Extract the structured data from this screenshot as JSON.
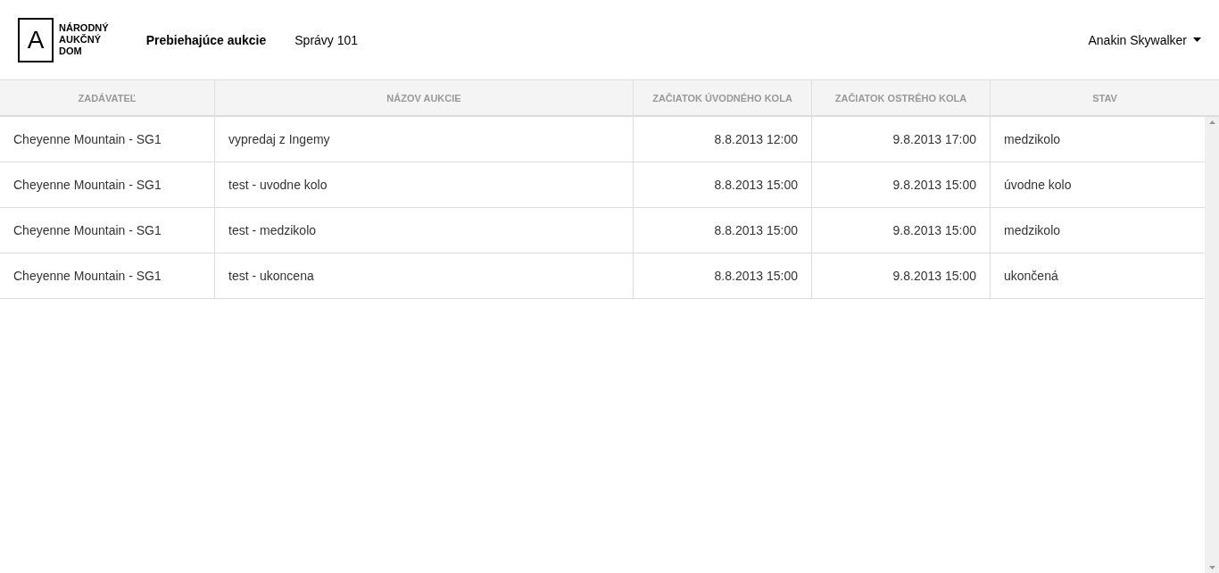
{
  "logo": {
    "letter": "A",
    "lines": [
      "NÁRODNÝ",
      "AUKČNÝ",
      "DOM"
    ]
  },
  "nav": [
    {
      "label": "Prebiehajúce aukcie",
      "selected": true
    },
    {
      "label": "Správy 101",
      "selected": false
    }
  ],
  "user": {
    "name": "Anakin Skywalker"
  },
  "table": {
    "columns": [
      {
        "label": "ZADÁVATEĽ"
      },
      {
        "label": "NÁZOV AUKCIE"
      },
      {
        "label": "ZAČIATOK ÚVODNÉHO KOLA"
      },
      {
        "label": "ZAČIATOK OSTRÉHO KOLA"
      },
      {
        "label": "STAV"
      }
    ],
    "rows": [
      [
        "Cheyenne Mountain - SG1",
        "vypredaj z Ingemy",
        "8.8.2013 12:00",
        "9.8.2013 17:00",
        "medzikolo"
      ],
      [
        "Cheyenne Mountain - SG1",
        "test - uvodne kolo",
        "8.8.2013 15:00",
        "9.8.2013 15:00",
        "úvodne kolo"
      ],
      [
        "Cheyenne Mountain - SG1",
        "test - medzikolo",
        "8.8.2013 15:00",
        "9.8.2013 15:00",
        "medzikolo"
      ],
      [
        "Cheyenne Mountain - SG1",
        "test - ukoncena",
        "8.8.2013 15:00",
        "9.8.2013 15:00",
        "ukončená"
      ]
    ]
  }
}
